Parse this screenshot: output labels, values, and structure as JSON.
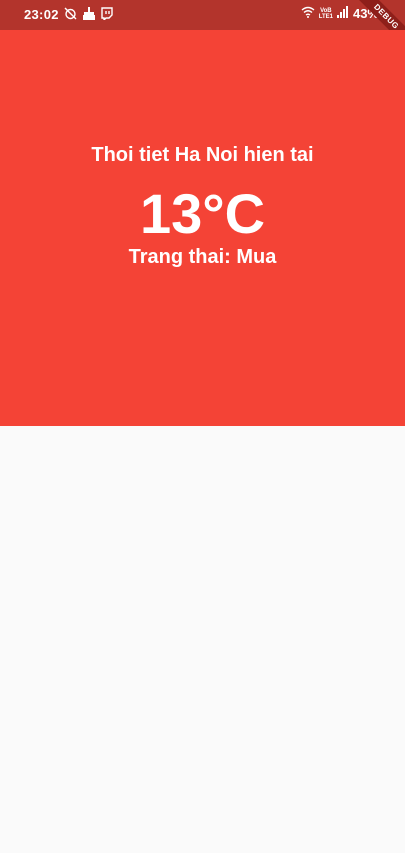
{
  "status_bar": {
    "time": "23:02",
    "left_icons": [
      "no-alarm-icon",
      "cleaner-icon",
      "twitch-icon"
    ],
    "right_icons": [
      "wifi-icon",
      "volte-lte-icon",
      "signal-icon"
    ],
    "volte_label_top": "VoB",
    "volte_label_bottom": "LTE1",
    "battery": "43%",
    "background_color": "#b3342c"
  },
  "debug_banner": {
    "label": "DEBUG"
  },
  "weather": {
    "title": "Thoi tiet Ha Noi hien tai",
    "temperature": "13°C",
    "status": "Trang thai: Mua",
    "background_color": "#f44336",
    "text_color": "#ffffff"
  }
}
